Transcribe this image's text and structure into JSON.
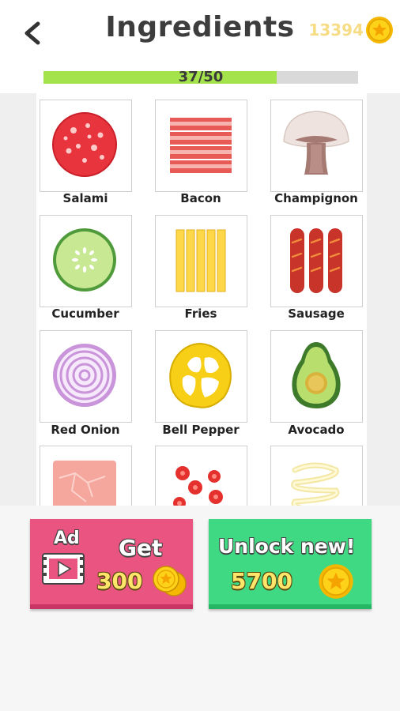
{
  "header": {
    "title": "Ingredients",
    "coins": "13394",
    "progress_text": "37/50",
    "progress_fraction": 0.74
  },
  "ingredients": [
    {
      "label": "Salami",
      "icon": "salami-icon"
    },
    {
      "label": "Bacon",
      "icon": "bacon-icon"
    },
    {
      "label": "Champignon",
      "icon": "champignon-icon"
    },
    {
      "label": "Cucumber",
      "icon": "cucumber-icon"
    },
    {
      "label": "Fries",
      "icon": "fries-icon"
    },
    {
      "label": "Sausage",
      "icon": "sausage-icon"
    },
    {
      "label": "Red Onion",
      "icon": "red-onion-icon"
    },
    {
      "label": "Bell Pepper",
      "icon": "bell-pepper-icon"
    },
    {
      "label": "Avocado",
      "icon": "avocado-icon"
    },
    {
      "label": "",
      "icon": "ham-icon"
    },
    {
      "label": "",
      "icon": "tomato-icon"
    },
    {
      "label": "",
      "icon": "mayo-icon"
    }
  ],
  "buttons": {
    "ad": {
      "ad_label": "Ad",
      "get_label": "Get",
      "amount": "300"
    },
    "unlock": {
      "label": "Unlock new!",
      "price": "5700"
    }
  },
  "colors": {
    "progress_fill": "#a5e34c",
    "coin_text": "#f6dc84",
    "ad_button": "#e95481",
    "unlock_button": "#3fd883"
  }
}
